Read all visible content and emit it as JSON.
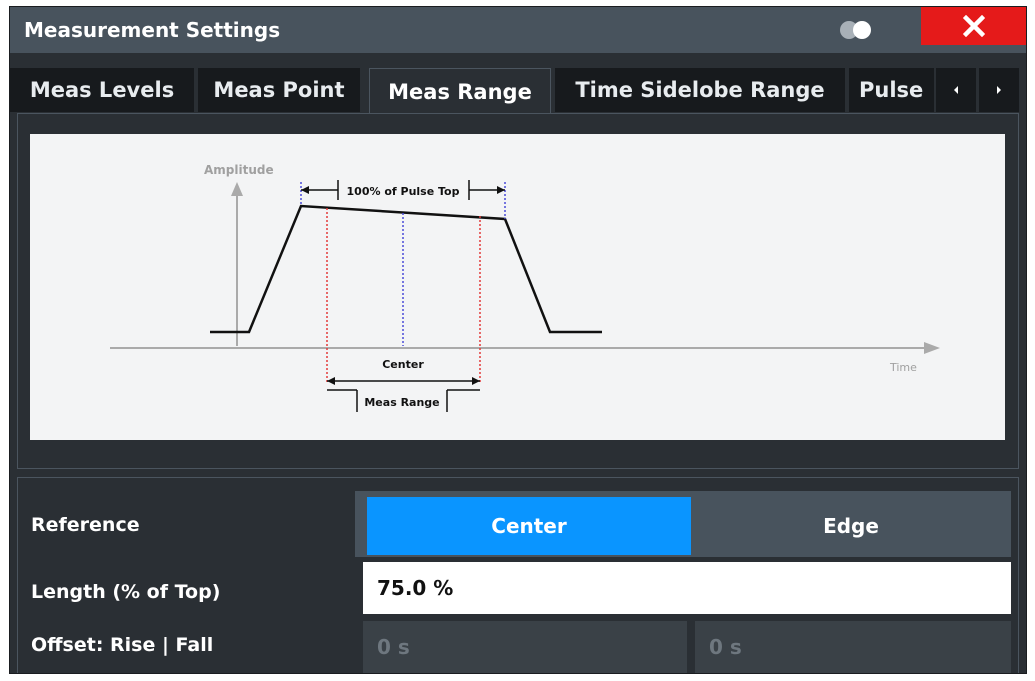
{
  "window": {
    "title": "Measurement Settings"
  },
  "tabs": [
    {
      "label": "Meas Levels"
    },
    {
      "label": "Meas Point"
    },
    {
      "label": "Meas Range"
    },
    {
      "label": "Time Sidelobe Range"
    },
    {
      "label": "Pulse"
    }
  ],
  "active_tab": "Meas Range",
  "diagram": {
    "amplitude_label": "Amplitude",
    "time_label": "Time",
    "pulse_top_label": "100% of Pulse Top",
    "center_label": "Center",
    "meas_range_label": "Meas Range"
  },
  "settings": {
    "reference": {
      "label": "Reference",
      "options": [
        "Center",
        "Edge"
      ],
      "selected": "Center"
    },
    "length": {
      "label": "Length (% of Top)",
      "value": "75.0 %"
    },
    "offset": {
      "label": "Offset: Rise | Fall",
      "rise_value": "0 s",
      "fall_value": "0 s"
    }
  },
  "colors": {
    "accent": "#0a95ff",
    "close": "#e51a1a",
    "panel": "#2a2f34",
    "title_bar": "#48535d",
    "center_marker": "#4b4bd8",
    "range_marker": "#e33a3a"
  },
  "icons": [
    "toggle-icon",
    "close-icon",
    "scroll-left-icon",
    "scroll-right-icon"
  ]
}
